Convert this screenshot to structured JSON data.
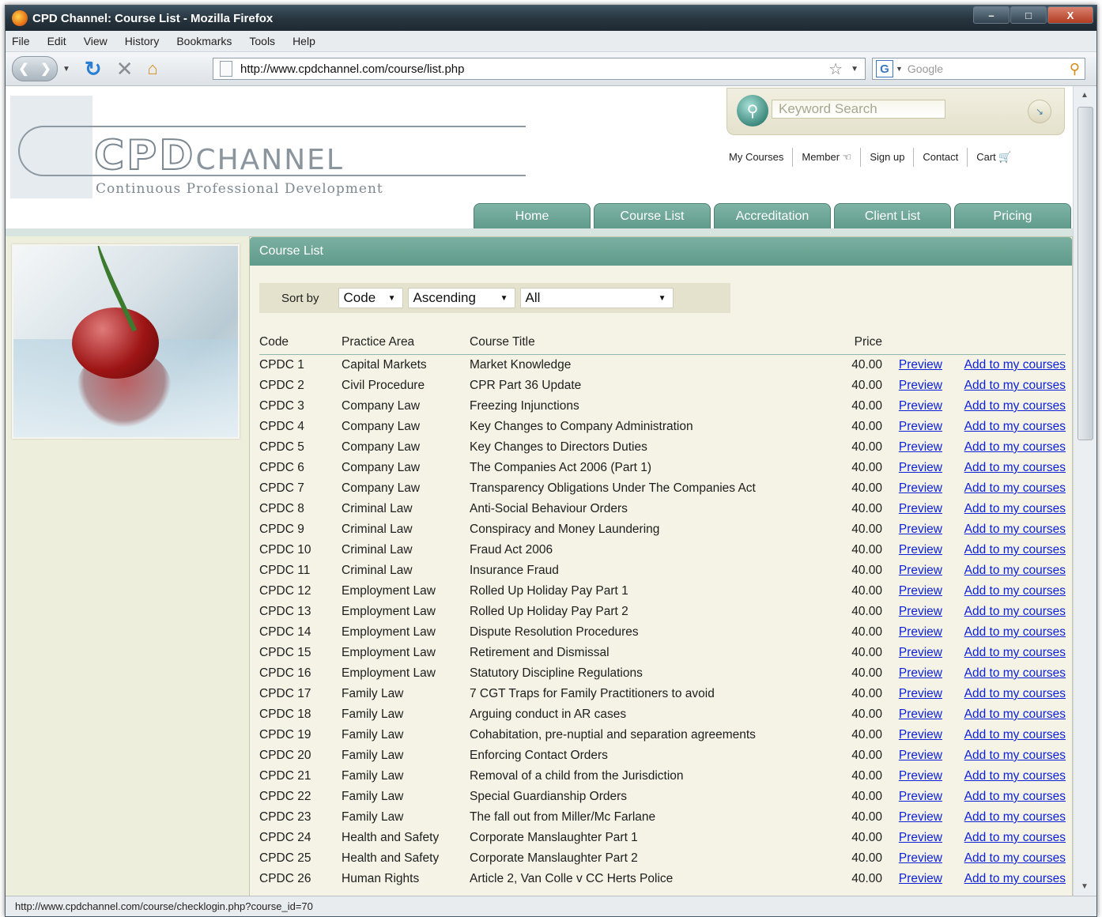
{
  "window": {
    "title": "CPD Channel: Course List - Mozilla Firefox",
    "controls": [
      "–",
      "□",
      "X"
    ]
  },
  "menu": [
    "File",
    "Edit",
    "View",
    "History",
    "Bookmarks",
    "Tools",
    "Help"
  ],
  "toolbar": {
    "url": "http://www.cpdchannel.com/course/list.php",
    "search_engine_glyph": "G",
    "search_placeholder": "Google"
  },
  "site": {
    "logo_main": "CPD",
    "logo_second": "CHANNEL",
    "logo_sub": "Continuous Professional Development",
    "keyword_placeholder": "Keyword Search",
    "top_links": [
      "My Courses",
      "Member",
      "Sign up",
      "Contact",
      "Cart"
    ],
    "tabs": [
      "Home",
      "Course List",
      "Accreditation",
      "Client List",
      "Pricing"
    ]
  },
  "panel": {
    "title": "Course List",
    "sort_label": "Sort by",
    "sort_field": "Code",
    "sort_order": "Ascending",
    "filter": "All"
  },
  "table": {
    "headers": [
      "Code",
      "Practice Area",
      "Course Title",
      "Price"
    ],
    "preview_label": "Preview",
    "add_label": "Add to my courses",
    "rows": [
      [
        "CPDC 1",
        "Capital Markets",
        "Market Knowledge",
        "40.00"
      ],
      [
        "CPDC 2",
        "Civil Procedure",
        "CPR Part 36 Update",
        "40.00"
      ],
      [
        "CPDC 3",
        "Company Law",
        "Freezing Injunctions",
        "40.00"
      ],
      [
        "CPDC 4",
        "Company Law",
        "Key Changes to Company Administration",
        "40.00"
      ],
      [
        "CPDC 5",
        "Company Law",
        "Key Changes to Directors Duties",
        "40.00"
      ],
      [
        "CPDC 6",
        "Company Law",
        "The Companies Act 2006 (Part 1)",
        "40.00"
      ],
      [
        "CPDC 7",
        "Company Law",
        "Transparency Obligations Under The Companies Act",
        "40.00"
      ],
      [
        "CPDC 8",
        "Criminal Law",
        "Anti-Social Behaviour Orders",
        "40.00"
      ],
      [
        "CPDC 9",
        "Criminal Law",
        "Conspiracy and Money Laundering",
        "40.00"
      ],
      [
        "CPDC 10",
        "Criminal Law",
        "Fraud Act 2006",
        "40.00"
      ],
      [
        "CPDC 11",
        "Criminal Law",
        "Insurance Fraud",
        "40.00"
      ],
      [
        "CPDC 12",
        "Employment Law",
        "Rolled Up Holiday Pay Part 1",
        "40.00"
      ],
      [
        "CPDC 13",
        "Employment Law",
        "Rolled Up Holiday Pay Part 2",
        "40.00"
      ],
      [
        "CPDC 14",
        "Employment Law",
        "Dispute Resolution Procedures",
        "40.00"
      ],
      [
        "CPDC 15",
        "Employment Law",
        "Retirement and Dismissal",
        "40.00"
      ],
      [
        "CPDC 16",
        "Employment Law",
        "Statutory Discipline Regulations",
        "40.00"
      ],
      [
        "CPDC 17",
        "Family Law",
        "7 CGT Traps for Family Practitioners to avoid",
        "40.00"
      ],
      [
        "CPDC 18",
        "Family Law",
        "Arguing conduct in AR cases",
        "40.00"
      ],
      [
        "CPDC 19",
        "Family Law",
        "Cohabitation, pre-nuptial and separation agreements",
        "40.00"
      ],
      [
        "CPDC 20",
        "Family Law",
        "Enforcing Contact Orders",
        "40.00"
      ],
      [
        "CPDC 21",
        "Family Law",
        "Removal of a child from the Jurisdiction",
        "40.00"
      ],
      [
        "CPDC 22",
        "Family Law",
        "Special Guardianship Orders",
        "40.00"
      ],
      [
        "CPDC 23",
        "Family Law",
        "The fall out from Miller/Mc Farlane",
        "40.00"
      ],
      [
        "CPDC 24",
        "Health and Safety",
        "Corporate Manslaughter Part 1",
        "40.00"
      ],
      [
        "CPDC 25",
        "Health and Safety",
        "Corporate Manslaughter Part 2",
        "40.00"
      ],
      [
        "CPDC 26",
        "Human Rights",
        "Article 2, Van Colle v CC Herts Police",
        "40.00"
      ]
    ]
  },
  "status": "http://www.cpdchannel.com/course/checklogin.php?course_id=70",
  "colors": {
    "tab_green": "#6aa596",
    "link_blue": "#0b1fd6",
    "panel_bg": "#f4f3e6"
  }
}
